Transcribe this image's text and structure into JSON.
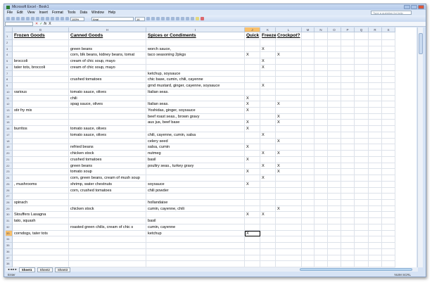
{
  "window": {
    "title": "Microsoft Excel - Book1"
  },
  "menu": [
    "File",
    "Edit",
    "View",
    "Insert",
    "Format",
    "Tools",
    "Data",
    "Window",
    "Help"
  ],
  "help_placeholder": "Type a question for help",
  "toolbar": {
    "zoom": "100%",
    "font": "Arial",
    "size": "14"
  },
  "formula": {
    "name_box": "",
    "value": "X"
  },
  "columns": [
    "G",
    "H",
    "I",
    "J",
    "K",
    "L",
    "M",
    "N",
    "O",
    "P",
    "Q",
    "R",
    "S"
  ],
  "active_column": "J",
  "active_row": 33,
  "rows": [
    [
      "Frozen Goods",
      "Canned Goods",
      "Spices or Condiments",
      "Quick",
      "Freeze",
      "Crockpot?"
    ],
    [
      "",
      "",
      "",
      "",
      "",
      ""
    ],
    [
      "",
      "green beans",
      "worch sauce,",
      "",
      "X",
      ""
    ],
    [
      "",
      "corn, blk beans, kidney beans, tomat",
      "taco seasoning 2pkgs",
      "X",
      "",
      "X"
    ],
    [
      "broccoli",
      "cream of chic soup, mayo",
      "",
      "",
      "X",
      ""
    ],
    [
      "tater tots, broccoli",
      "cream of chic soup, mayo",
      "",
      "",
      "X",
      ""
    ],
    [
      "",
      "",
      "ketchup, soysauce",
      "",
      "",
      ""
    ],
    [
      "",
      "crushed tomatoes",
      "chic base, cumin, chili, cayenne",
      "",
      "",
      ""
    ],
    [
      "",
      "",
      "grnd mustard, ginger, cayenne, soysauce",
      "",
      "X",
      ""
    ],
    [
      "various",
      "tomato sauce, olives",
      "Italian seas.",
      "",
      "",
      ""
    ],
    [
      "",
      "chili",
      "",
      "X",
      "",
      ""
    ],
    [
      "",
      "spag sauce, olives",
      "Italian seas.",
      "X",
      "",
      "X"
    ],
    [
      "stir fry mix",
      "",
      "Yoshidas, ginger, soysauce",
      "X",
      "",
      ""
    ],
    [
      "",
      "",
      "beef roast seas., brown gravy",
      "",
      "",
      "X"
    ],
    [
      "",
      "",
      "aus jus, beef base",
      "X",
      "",
      "X"
    ],
    [
      "burritos",
      "tomato sauce, olives",
      "",
      "X",
      "",
      ""
    ],
    [
      "",
      "tomato sauce, olives",
      "chili, cayenne, cumin, salsa",
      "",
      "X",
      ""
    ],
    [
      "",
      "",
      "celery seed",
      "",
      "",
      "X"
    ],
    [
      "",
      "refried beans",
      "salsa, cumin",
      "X",
      "",
      ""
    ],
    [
      "",
      "chicken stock",
      "nutmeg",
      "",
      "X",
      "X"
    ],
    [
      "",
      "crushed tomatoes",
      "basil",
      "X",
      "",
      ""
    ],
    [
      "",
      "green beans",
      "poultry seas., turkey gravy",
      "",
      "X",
      "X"
    ],
    [
      "",
      "tomato soup",
      "",
      "X",
      "",
      "X"
    ],
    [
      "",
      "corn, green beans, cream of mush soup",
      "",
      "",
      "X",
      ""
    ],
    [
      ", mushrooms",
      "shrimp, water chestnuts",
      "soysauce",
      "X",
      "",
      ""
    ],
    [
      "",
      "corn, crushed tomatoes",
      "chili powder",
      "",
      "",
      ""
    ],
    [
      "",
      "",
      "",
      "",
      "",
      ""
    ],
    [
      "spinach",
      "",
      "hollandaise",
      "",
      "",
      ""
    ],
    [
      "",
      "chicken stock",
      "cumin, cayenne, chili",
      "",
      "",
      "X"
    ],
    [
      "Stouffers Lasagna",
      "",
      "",
      "X",
      "X",
      ""
    ],
    [
      "tato, squash",
      "",
      "basil",
      "",
      "",
      ""
    ],
    [
      "",
      "roasted green chilis, cream of chic s",
      "cumin, cayenne",
      "",
      "",
      ""
    ],
    [
      "corndogs, tater tots",
      "",
      "ketchup",
      "X",
      "",
      ""
    ],
    [
      "",
      "",
      "",
      "",
      "",
      ""
    ],
    [
      "",
      "",
      "",
      "",
      "",
      ""
    ],
    [
      "",
      "",
      "",
      "",
      "",
      ""
    ],
    [
      "",
      "",
      "",
      "",
      "",
      ""
    ],
    [
      "",
      "",
      "",
      "",
      "",
      ""
    ]
  ],
  "sheets": [
    "Sheet1",
    "Sheet2",
    "Sheet3"
  ],
  "status": {
    "mode": "Enter",
    "indicators": "NUM SCRL"
  }
}
